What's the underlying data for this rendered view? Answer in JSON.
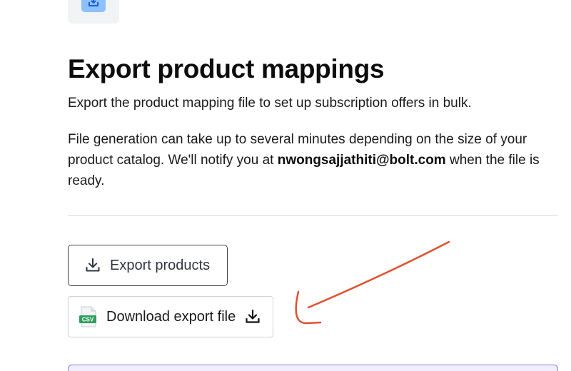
{
  "header": {
    "icon": "download-box-icon"
  },
  "main": {
    "title": "Export product mappings",
    "subtitle": "Export the product mapping file to set up subscription offers in bulk.",
    "notice": {
      "before": "File generation can take up to several minutes depending on the size of your product catalog. We'll notify you at ",
      "email": "nwongsajjathiti@bolt.com",
      "after": " when the file is ready."
    }
  },
  "actions": {
    "export_button": {
      "label": "Export products",
      "icon": "download-icon"
    },
    "download_button": {
      "label": "Download export file",
      "file_badge": "CSV",
      "file_icon": "csv-file-icon",
      "icon": "download-icon"
    }
  },
  "annotation": {
    "type": "hand-drawn-arrow",
    "color": "#e0502f"
  },
  "colors": {
    "accent_blue": "#8cc0ff",
    "border_dark": "#3a3f47",
    "csv_green": "#2e9e5b",
    "banner_purple": "#8a7fe0"
  }
}
